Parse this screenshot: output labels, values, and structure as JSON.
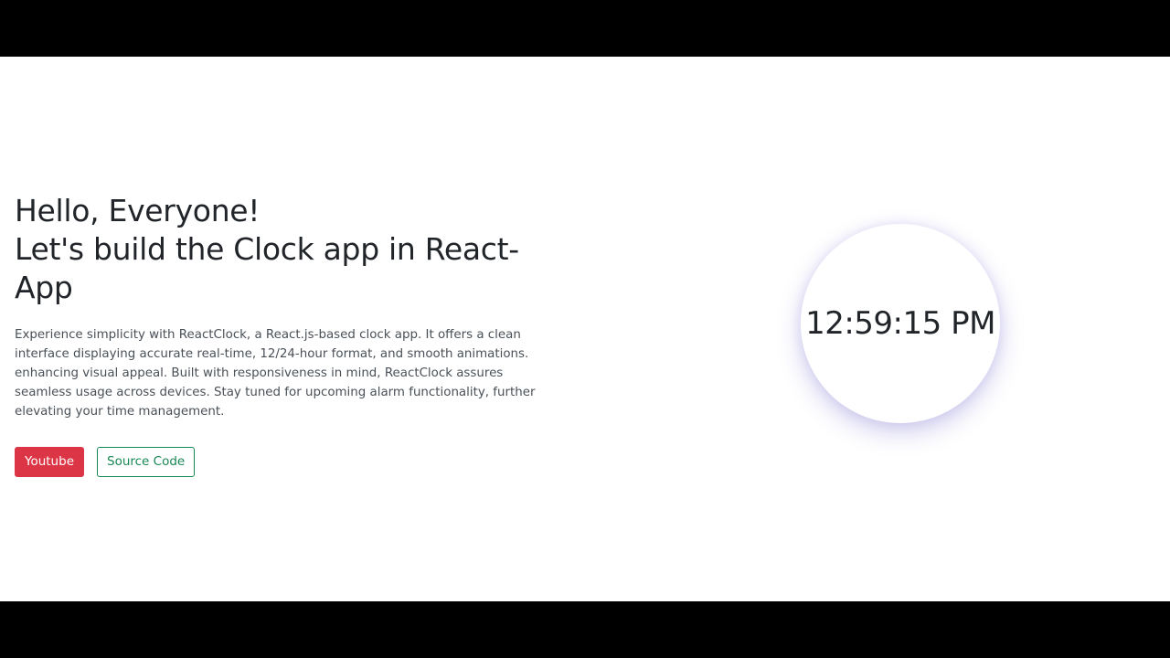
{
  "hero": {
    "greeting": "Hello, Everyone!",
    "headline_line2": "Let's build the Clock app in React-",
    "headline_line3": "App",
    "description": "Experience simplicity with ReactClock, a React.js-based clock app. It offers a clean interface displaying accurate real-time, 12/24-hour format, and smooth animations. enhancing visual appeal. Built with responsiveness in mind, ReactClock assures seamless usage across devices. Stay tuned for upcoming alarm functionality, further elevating your time management."
  },
  "buttons": {
    "youtube_label": "Youtube",
    "source_label": "Source Code"
  },
  "clock": {
    "time": "12:59:15 PM"
  },
  "colors": {
    "youtube_button": "#dc3545",
    "source_button": "#198754",
    "text": "#212529",
    "letterbox": "#000000"
  }
}
